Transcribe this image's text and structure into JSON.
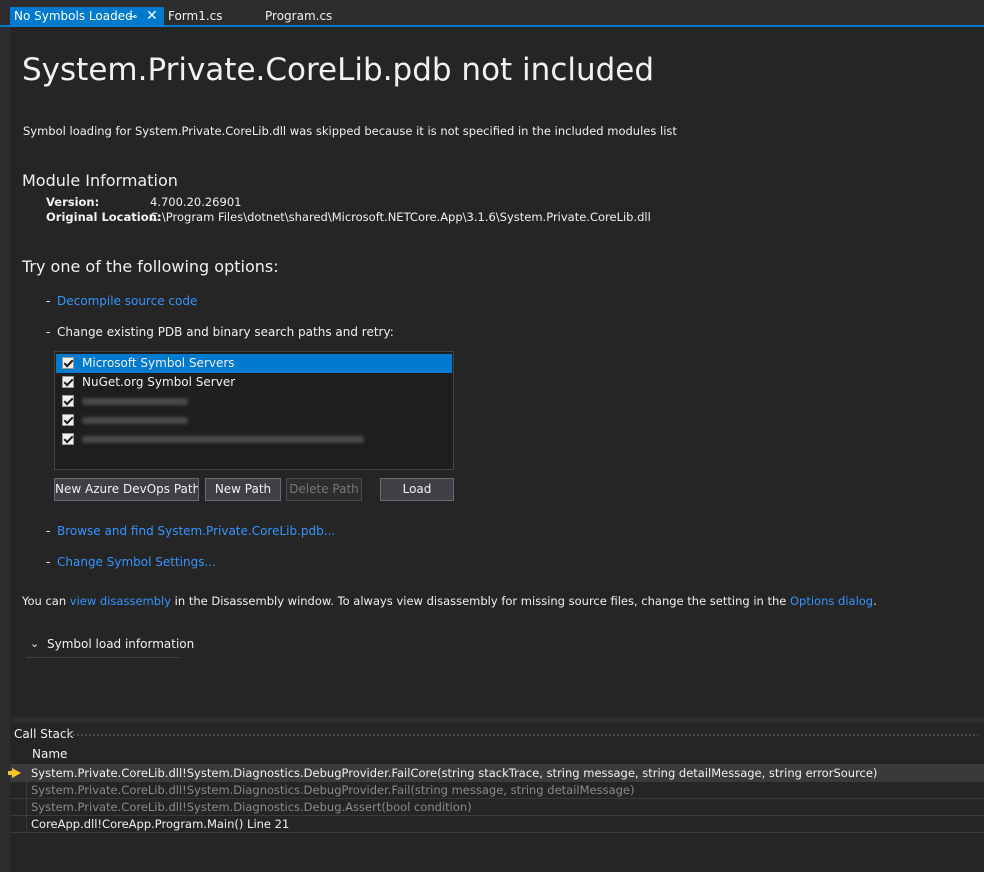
{
  "tabs": [
    {
      "label": "No Symbols Loaded",
      "active": true
    },
    {
      "label": "Form1.cs",
      "active": false
    },
    {
      "label": "Program.cs",
      "active": false
    }
  ],
  "page": {
    "title": "System.Private.CoreLib.pdb not included",
    "description": "Symbol loading for System.Private.CoreLib.dll was skipped because it is not specified in the included modules list"
  },
  "module_info": {
    "heading": "Module Information",
    "version_label": "Version:",
    "version_value": "4.700.20.26901",
    "location_label": "Original Location:",
    "location_value": "C:\\Program Files\\dotnet\\shared\\Microsoft.NETCore.App\\3.1.6\\System.Private.CoreLib.dll"
  },
  "options": {
    "heading": "Try one of the following options:",
    "decompile_link": "Decompile source code",
    "change_paths_text": "Change existing PDB and binary search paths and retry:",
    "browse_link": "Browse and find System.Private.CoreLib.pdb...",
    "settings_link": "Change Symbol Settings..."
  },
  "path_list": [
    {
      "label": "Microsoft Symbol Servers",
      "checked": true,
      "selected": true
    },
    {
      "label": "NuGet.org Symbol Server",
      "checked": true,
      "selected": false
    },
    {
      "label": "",
      "checked": true,
      "selected": false
    },
    {
      "label": "",
      "checked": true,
      "selected": false
    },
    {
      "label": "",
      "checked": true,
      "selected": false
    }
  ],
  "buttons": {
    "azure": "New Azure DevOps Path...",
    "new_path": "New Path",
    "delete_path": "Delete Path",
    "load": "Load"
  },
  "footer": {
    "prefix": "You can ",
    "disasm_link": "view disassembly",
    "middle": " in the Disassembly window. To always view disassembly for missing source files, change the setting in the ",
    "options_link": "Options dialog",
    "suffix": "."
  },
  "expander": {
    "label": "Symbol load information"
  },
  "call_stack": {
    "title": "Call Stack",
    "column": "Name",
    "rows": [
      {
        "text": "System.Private.CoreLib.dll!System.Diagnostics.DebugProvider.FailCore(string stackTrace, string message, string detailMessage, string errorSource)",
        "current": true,
        "dim": false
      },
      {
        "text": "System.Private.CoreLib.dll!System.Diagnostics.DebugProvider.Fail(string message, string detailMessage)",
        "current": false,
        "dim": true
      },
      {
        "text": "System.Private.CoreLib.dll!System.Diagnostics.Debug.Assert(bool condition)",
        "current": false,
        "dim": true
      },
      {
        "text": "CoreApp.dll!CoreApp.Program.Main() Line 21",
        "current": false,
        "dim": false
      }
    ]
  },
  "colors": {
    "accent": "#007acc",
    "link": "#3794ff",
    "background": "#252526",
    "current_frame_arrow": "#f5c92a"
  }
}
